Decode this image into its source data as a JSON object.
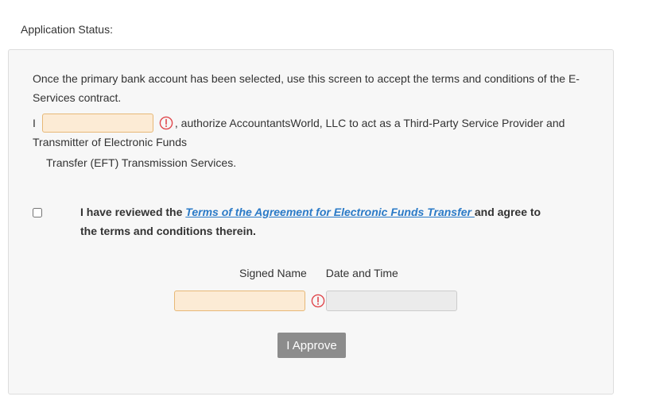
{
  "header": {
    "status_label": "Application Status:"
  },
  "panel": {
    "intro_text": "Once the primary bank account has been selected, use this screen to accept the terms and conditions of the E-Services contract.",
    "auth": {
      "prefix": "I",
      "name_value": "",
      "rest_line1": ", authorize AccountantsWorld, LLC to act as a Third-Party Service Provider and",
      "line2": "Transmitter of Electronic Funds",
      "line3": "Transfer (EFT) Transmission Services."
    },
    "agreement": {
      "checked": false,
      "text_before": "I have reviewed the ",
      "link_text": "Terms of the Agreement for Electronic Funds Transfer ",
      "text_after": "and agree to the terms and conditions therein."
    },
    "signature": {
      "signed_name_label": "Signed Name",
      "date_time_label": "Date and Time",
      "signed_name_value": "",
      "date_time_value": ""
    },
    "approve_button_label": "I Approve"
  },
  "icons": {
    "required_warning": "warning-circle-icon"
  },
  "colors": {
    "required_input_bg": "#fcebd5",
    "required_input_border": "#e7b877",
    "warning_red": "#e0474c",
    "link_blue": "#2a7ac7",
    "button_bg": "#8c8c8c",
    "panel_bg": "#f7f7f7"
  }
}
